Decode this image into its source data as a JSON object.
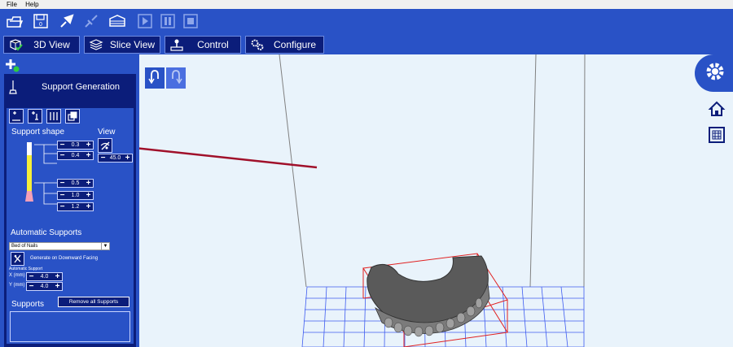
{
  "menu": {
    "file": "File",
    "help": "Help"
  },
  "toolbar": {
    "items": [
      "open-icon",
      "save-icon",
      "connect-icon",
      "disconnect-icon",
      "slice-icon",
      "play-icon",
      "pause-icon",
      "stop-icon"
    ]
  },
  "tabs": [
    {
      "label": "3D View",
      "icon": "cube-icon"
    },
    {
      "label": "Slice View",
      "icon": "layers-icon"
    },
    {
      "label": "Control",
      "icon": "joystick-icon"
    },
    {
      "label": "Configure",
      "icon": "gears-icon"
    }
  ],
  "panel": {
    "title": "Support Generation",
    "support_shape_label": "Support shape",
    "view_label": "View",
    "view_angle": "45.0",
    "top_values": [
      "0.3",
      "0.4"
    ],
    "bottom_values": [
      "0.5",
      "1.0",
      "1.2"
    ],
    "automatic_supports_label": "Automatic Supports",
    "dropdown_value": "Bed of Nails",
    "downward_label": "Generate on Downward Facing",
    "auto_support_label": "Automatic Support",
    "x_label": "X (mm)",
    "y_label": "Y (mm)",
    "x_value": "4.0",
    "y_value": "4.0",
    "supports_label": "Supports",
    "remove_button": "Remove all Supports"
  },
  "colors": {
    "toolbar": "#2952c6",
    "panel": "#0b1d7a",
    "viewport": "#e9f3fb",
    "grid": "#3f5cf0",
    "box": "#e02020",
    "arrow": "#a0102a"
  }
}
